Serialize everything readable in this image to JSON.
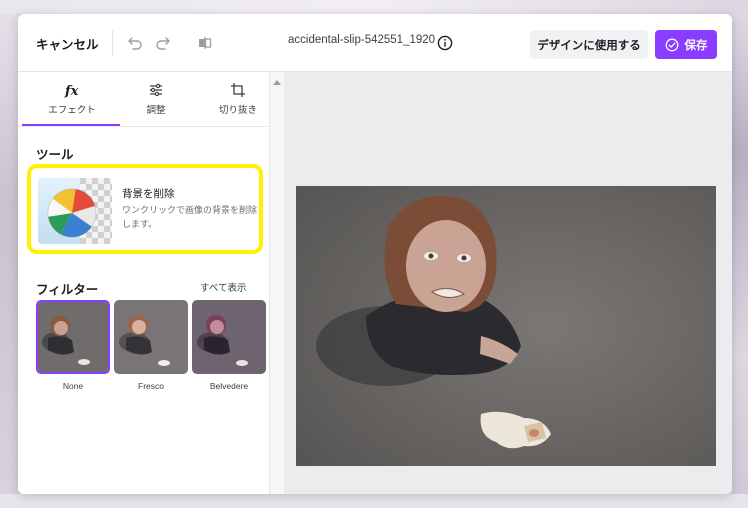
{
  "header": {
    "cancel_label": "キャンセル",
    "filename": "accidental-slip-542551_1920",
    "use_in_design_label": "デザインに使用する",
    "save_label": "保存"
  },
  "tabs": [
    {
      "label": "エフェクト",
      "icon": "fx-icon",
      "active": true
    },
    {
      "label": "調整",
      "icon": "sliders-icon",
      "active": false
    },
    {
      "label": "切り抜き",
      "icon": "crop-icon",
      "active": false
    }
  ],
  "tools": {
    "heading": "ツール",
    "remove_bg": {
      "title": "背景を削除",
      "description": "ワンクリックで画像の背景を削除します。"
    }
  },
  "filters": {
    "heading": "フィルター",
    "see_all": "すべて表示",
    "items": [
      {
        "label": "None",
        "selected": true
      },
      {
        "label": "Fresco",
        "selected": false
      },
      {
        "label": "Belvedere",
        "selected": false
      }
    ]
  },
  "colors": {
    "accent": "#8b3dff",
    "highlight": "#fff200"
  }
}
